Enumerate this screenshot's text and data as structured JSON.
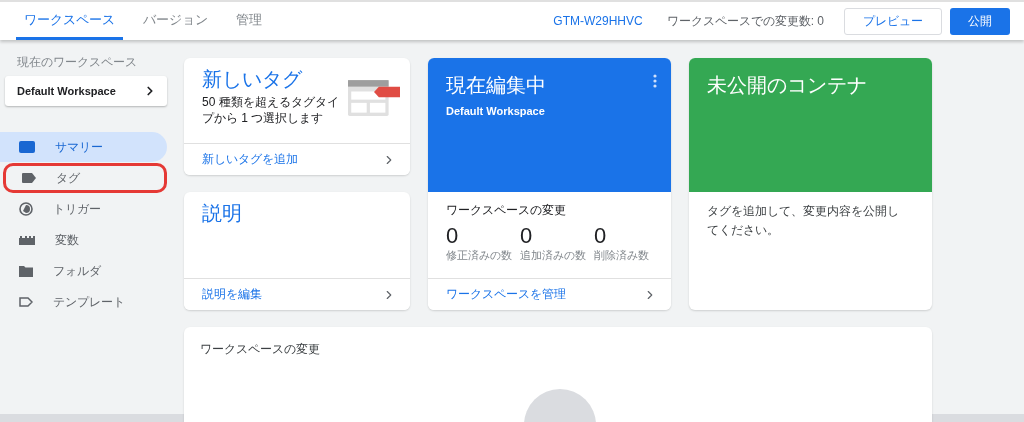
{
  "tabs": [
    {
      "label": "ワークスペース",
      "selected": true
    },
    {
      "label": "バージョン",
      "selected": false
    },
    {
      "label": "管理",
      "selected": false
    }
  ],
  "header": {
    "container_id": "GTM-W29HHVC",
    "changes": "ワークスペースでの変更数: 0",
    "preview": "プレビュー",
    "publish": "公開"
  },
  "sidebar": {
    "workspace_label": "現在のワークスペース",
    "workspace": "Default Workspace",
    "items": [
      {
        "label": "サマリー",
        "kind": "summary",
        "selected": true,
        "highlighted": false
      },
      {
        "label": "タグ",
        "kind": "tag",
        "selected": false,
        "highlighted": true
      },
      {
        "label": "トリガー",
        "kind": "trigger",
        "selected": false,
        "highlighted": false
      },
      {
        "label": "変数",
        "kind": "variable",
        "selected": false,
        "highlighted": false
      },
      {
        "label": "フォルダ",
        "kind": "folder",
        "selected": false,
        "highlighted": false
      },
      {
        "label": "テンプレート",
        "kind": "template",
        "selected": false,
        "highlighted": false
      }
    ]
  },
  "new_tag": {
    "title": "新しいタグ",
    "description": "50 種類を超えるタグタイプから 1 つ選択します",
    "link": "新しいタグを追加"
  },
  "description_card": {
    "title": "説明",
    "link": "説明を編集"
  },
  "current": {
    "title": "現在編集中",
    "workspace": "Default Workspace",
    "changes_title": "ワークスペースの変更",
    "stats": [
      {
        "value": "0",
        "label": "修正済みの数"
      },
      {
        "value": "0",
        "label": "追加済みの数"
      },
      {
        "value": "0",
        "label": "削除済み数"
      }
    ],
    "link": "ワークスペースを管理"
  },
  "unpublished": {
    "title": "未公開のコンテナ",
    "message": "タグを追加して、変更内容を公開してください。"
  },
  "changes_panel": {
    "title": "ワークスペースの変更"
  }
}
